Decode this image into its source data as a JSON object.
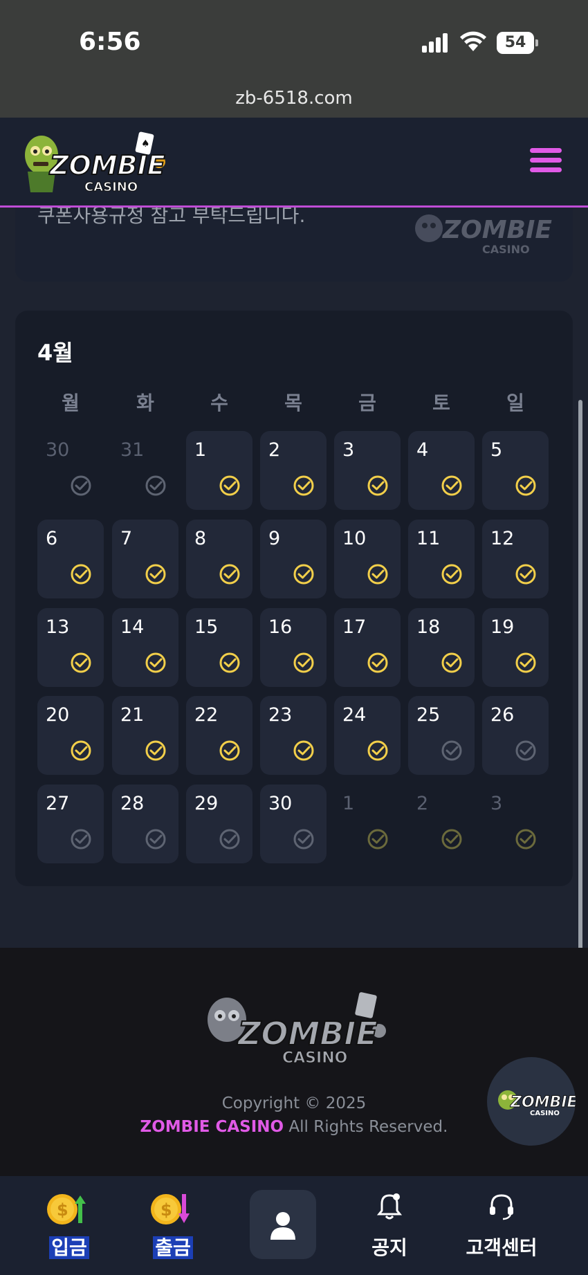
{
  "status_bar": {
    "time": "6:56",
    "battery": "54"
  },
  "browser": {
    "url": "zb-6518.com"
  },
  "header": {
    "logo_text": "ZOMBIE",
    "logo_sub": "CASINO"
  },
  "notice": {
    "text": "쿠폰사용규정 참고 부탁드립니다."
  },
  "calendar": {
    "month": "4월",
    "weekdays": [
      "월",
      "화",
      "수",
      "목",
      "금",
      "토",
      "일"
    ],
    "weeks": [
      [
        {
          "d": "30",
          "dim": true,
          "check": "gray"
        },
        {
          "d": "31",
          "dim": true,
          "check": "gray"
        },
        {
          "d": "1",
          "check": "yellow"
        },
        {
          "d": "2",
          "check": "yellow"
        },
        {
          "d": "3",
          "check": "yellow"
        },
        {
          "d": "4",
          "check": "yellow"
        },
        {
          "d": "5",
          "check": "yellow"
        }
      ],
      [
        {
          "d": "6",
          "check": "yellow"
        },
        {
          "d": "7",
          "check": "yellow"
        },
        {
          "d": "8",
          "check": "yellow"
        },
        {
          "d": "9",
          "check": "yellow"
        },
        {
          "d": "10",
          "check": "yellow"
        },
        {
          "d": "11",
          "check": "yellow"
        },
        {
          "d": "12",
          "check": "yellow"
        }
      ],
      [
        {
          "d": "13",
          "check": "yellow"
        },
        {
          "d": "14",
          "check": "yellow"
        },
        {
          "d": "15",
          "check": "yellow"
        },
        {
          "d": "16",
          "check": "yellow"
        },
        {
          "d": "17",
          "check": "yellow"
        },
        {
          "d": "18",
          "check": "yellow"
        },
        {
          "d": "19",
          "check": "yellow"
        }
      ],
      [
        {
          "d": "20",
          "check": "yellow"
        },
        {
          "d": "21",
          "check": "yellow"
        },
        {
          "d": "22",
          "check": "yellow"
        },
        {
          "d": "23",
          "check": "yellow"
        },
        {
          "d": "24",
          "check": "yellow"
        },
        {
          "d": "25",
          "check": "gray"
        },
        {
          "d": "26",
          "check": "gray"
        }
      ],
      [
        {
          "d": "27",
          "check": "gray"
        },
        {
          "d": "28",
          "check": "gray"
        },
        {
          "d": "29",
          "check": "gray"
        },
        {
          "d": "30",
          "check": "gray"
        },
        {
          "d": "1",
          "dim": true,
          "check": "olive"
        },
        {
          "d": "2",
          "dim": true,
          "check": "olive"
        },
        {
          "d": "3",
          "dim": true,
          "check": "olive"
        }
      ]
    ]
  },
  "footer": {
    "copyright": "Copyright © 2025",
    "brand": "ZOMBIE CASINO",
    "reserved": " All Rights Reserved."
  },
  "bottom_nav": {
    "deposit": "입금",
    "withdraw": "출금",
    "notice": "공지",
    "support": "고객센터"
  },
  "colors": {
    "accent": "#e05ae6",
    "check_yellow": "#f2cf4a",
    "check_gray": "#5e6472",
    "check_olive": "#6b6a3c"
  },
  "icons": {
    "menu": "hamburger-icon",
    "profile": "user-icon",
    "notice": "bell-icon",
    "support": "headset-icon",
    "deposit": "coin-up-icon",
    "withdraw": "coin-down-icon"
  }
}
